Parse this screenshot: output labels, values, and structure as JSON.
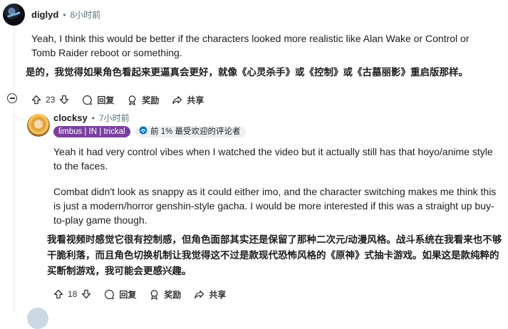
{
  "comment1": {
    "username": "diglyd",
    "separator": "•",
    "time": "8小时前",
    "body_en": "Yeah, I think this would be better if the characters looked more realistic like Alan Wake or Control or Tomb Raider reboot or something.",
    "body_zh": "是的，我觉得如果角色看起来更逼真会更好，就像《心灵杀手》或《控制》或《古墓丽影》重启版那样。",
    "votes": "23",
    "reply_label": "回复",
    "award_label": "奖励",
    "share_label": "共享"
  },
  "comment2": {
    "username": "clocksy",
    "separator": "•",
    "time": "7小时前",
    "flair": "limbus | IN | trickal",
    "badge": "前 1% 最受欢迎的评论者",
    "body_en_1": "Yeah it had very control vibes when I watched the video but it actually still has that hoyo/anime style to the faces.",
    "body_en_2": "Combat didn't look as snappy as it could either imo, and the character switching makes me think this is just a modern/horror genshin-style gacha. I would be more interested if this was a straight up buy-to-play game though.",
    "body_zh": "我看视频时感觉它很有控制感，但角色面部其实还是保留了那种二次元/动漫风格。战斗系统在我看来也不够干脆利落，而且角色切换机制让我觉得这不过是款现代恐怖风格的《原神》式抽卡游戏。如果这是款纯粹的买断制游戏，我可能会更感兴趣。",
    "votes": "18",
    "reply_label": "回复",
    "award_label": "奖励",
    "share_label": "共享"
  },
  "colors": {
    "flair_bg": "#7a3fa0",
    "meta_text": "#576f76",
    "thread_line": "#e5ebee"
  },
  "icons": [
    "upvote-icon",
    "downvote-icon",
    "reply-bubble-icon",
    "award-icon",
    "share-icon",
    "collapse-icon",
    "top-commenter-icon"
  ]
}
